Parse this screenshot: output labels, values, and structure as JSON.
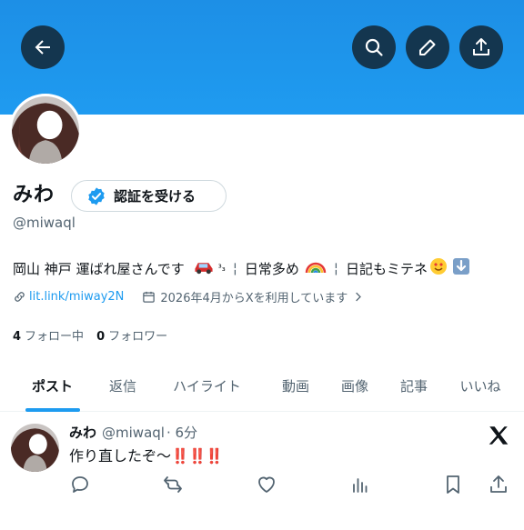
{
  "header": {
    "back_icon": "arrow-left-icon",
    "search_icon": "search-icon",
    "edit_icon": "pencil-icon",
    "share_icon": "share-icon",
    "banner_color": "#1d9bf0",
    "button_color": "#14364f"
  },
  "profile": {
    "display_name": "みわ",
    "verify_label": "認証を受ける",
    "handle": "@miwaql",
    "bio_text": "岡山 神戸 運ばれ屋さんです",
    "bio_sep1": "¦",
    "bio_text2": "日常多め",
    "bio_sep2": "¦",
    "bio_text3": "日記もミテネ",
    "link_text": "lit.link/miway2N",
    "joined_text": "2026年4月からXを利用しています",
    "following_count": "4",
    "following_label": "フォロー中",
    "followers_count": "0",
    "followers_label": "フォロワー"
  },
  "tabs": [
    {
      "label": "ポスト",
      "active": true
    },
    {
      "label": "返信"
    },
    {
      "label": "ハイライト"
    },
    {
      "label": "動画"
    },
    {
      "label": "画像"
    },
    {
      "label": "記事"
    },
    {
      "label": "いいね"
    }
  ],
  "post": {
    "author": "みわ",
    "handle": "@miwaql",
    "time": "· 6分",
    "text": "作り直したぞ〜",
    "text_suffix": "‼️‼️‼️"
  },
  "colors": {
    "accent": "#1d9bf0",
    "text": "#0f1419",
    "subtext": "#536471"
  }
}
